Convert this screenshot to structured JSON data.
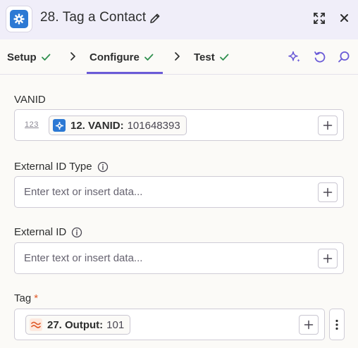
{
  "header": {
    "title": "28. Tag a Contact",
    "app_icon": "ngp-van-gear-icon",
    "edit_icon": "pencil-icon",
    "expand_icon": "expand-icon",
    "close_icon": "close-icon"
  },
  "tabs": [
    {
      "label": "Setup",
      "status": "complete"
    },
    {
      "label": "Configure",
      "status": "complete",
      "active": true
    },
    {
      "label": "Test",
      "status": "complete"
    }
  ],
  "tools": [
    "ai-sparkle-icon",
    "undo-icon",
    "search-icon"
  ],
  "fields": {
    "vanid": {
      "label": "VANID",
      "type_hint": "123",
      "value_pill": {
        "step": "12. VANID:",
        "value": "101648393"
      }
    },
    "external_id_type": {
      "label": "External ID Type",
      "placeholder": "Enter text or insert data..."
    },
    "external_id": {
      "label": "External ID",
      "placeholder": "Enter text or insert data..."
    },
    "tag": {
      "label": "Tag",
      "required_mark": "*",
      "value_pill": {
        "step": "27. Output:",
        "value": "101"
      }
    }
  },
  "colors": {
    "accent": "#6a5bd7",
    "check_green": "#2f8f4e",
    "required": "#e05a2a",
    "header_bg": "#f0eef9",
    "app_blue": "#2c79d4",
    "formatter_orange": "#e05a2a"
  }
}
